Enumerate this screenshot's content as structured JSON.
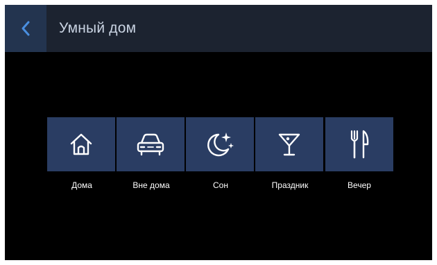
{
  "header": {
    "title": "Умный дом",
    "back_icon": "chevron-left-icon",
    "accent_color": "#4a8fe0"
  },
  "scenes": [
    {
      "label": "Дома",
      "icon": "home-icon"
    },
    {
      "label": "Вне дома",
      "icon": "car-icon"
    },
    {
      "label": "Сон",
      "icon": "moon-stars-icon"
    },
    {
      "label": "Праздник",
      "icon": "cocktail-icon"
    },
    {
      "label": "Вечер",
      "icon": "fork-knife-icon"
    }
  ]
}
